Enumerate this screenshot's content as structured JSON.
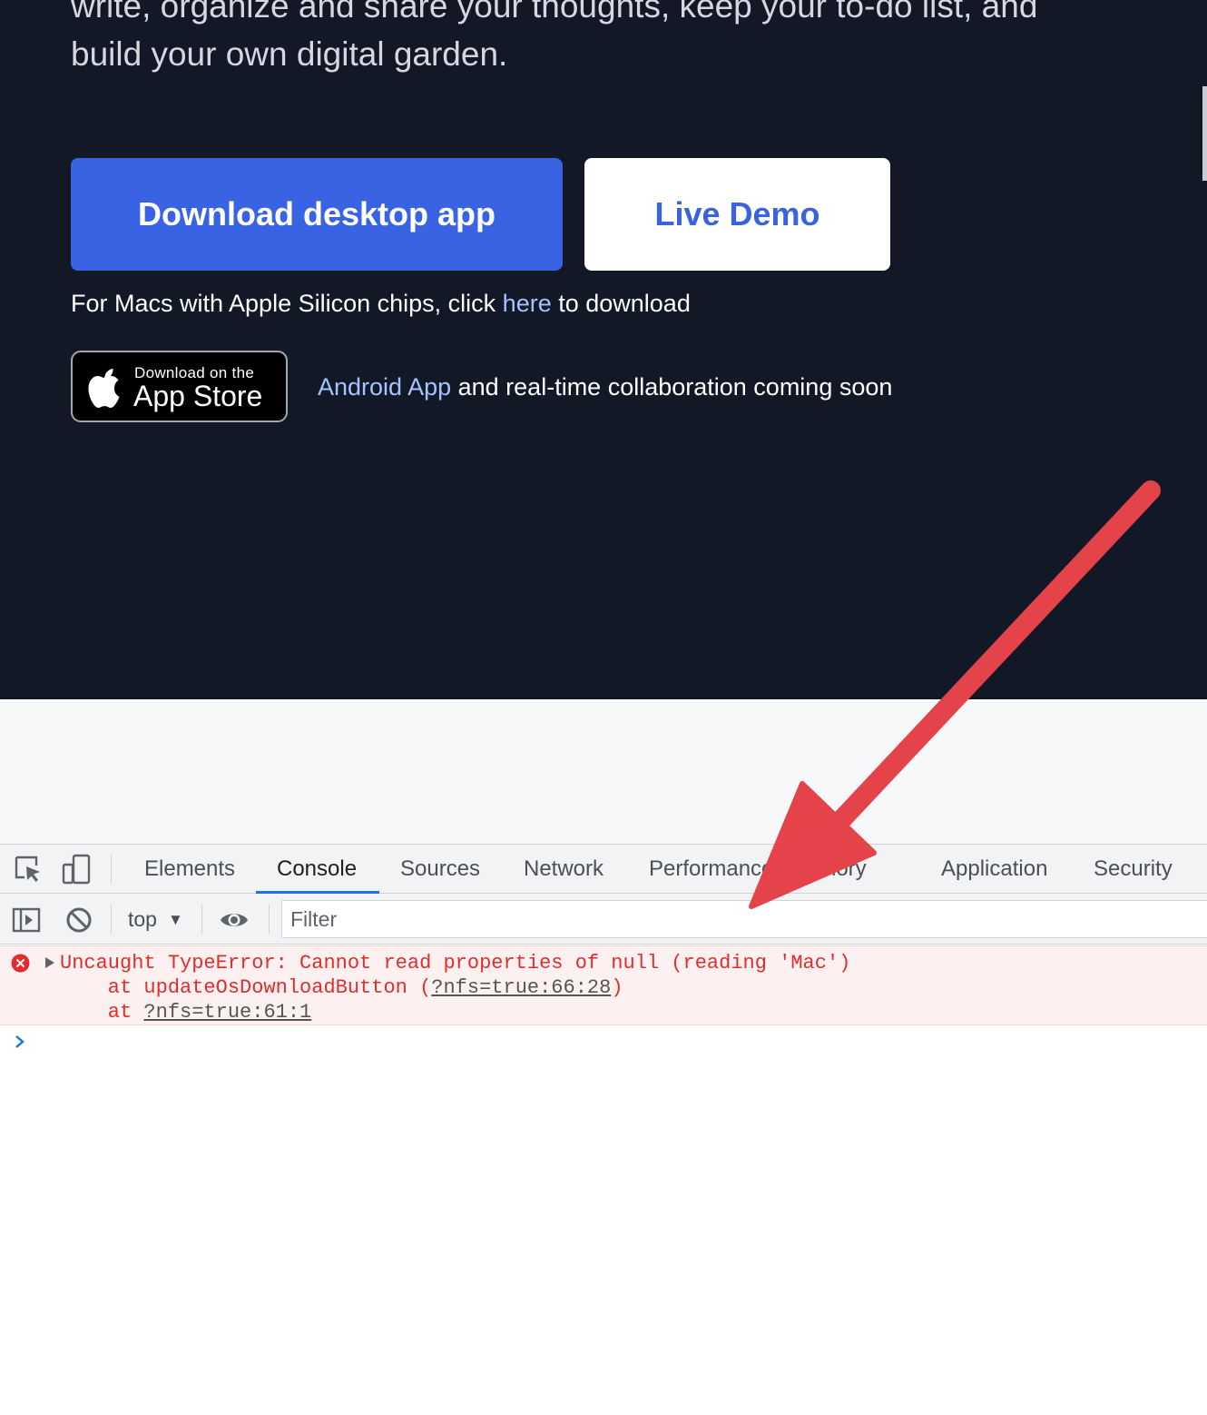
{
  "hero": {
    "intro_line1": "write, organize and share your thoughts, keep your to-do list, and",
    "intro_line2": "build your own digital garden.",
    "download_button": "Download desktop app",
    "demo_button": "Live Demo",
    "silicon_prefix": "For Macs with Apple Silicon chips, click ",
    "silicon_link": "here",
    "silicon_suffix": " to download",
    "appstore_small": "Download on the",
    "appstore_big": "App Store",
    "android_link": "Android App",
    "android_suffix": " and real-time collaboration coming soon"
  },
  "devtools": {
    "tabs": [
      "Elements",
      "Console",
      "Sources",
      "Network",
      "Performance",
      "Memory",
      "Application",
      "Security"
    ],
    "active_tab": "Console",
    "context": "top",
    "filter_placeholder": "Filter",
    "error": {
      "message": "Uncaught TypeError: Cannot read properties of null (reading 'Mac')",
      "trace1_prefix": "    at updateOsDownloadButton (",
      "trace1_link": "?nfs=true:66:28",
      "trace1_suffix": ")",
      "trace2_prefix": "    at ",
      "trace2_link": "?nfs=true:61:1"
    }
  },
  "colors": {
    "hero_bg": "#131827",
    "primary": "#3a63e4",
    "link": "#a4c4ff",
    "error_text": "#e02d2d",
    "error_bg": "#fdf0f0",
    "annotation_arrow": "#e5434a"
  },
  "icons": [
    "apple-icon",
    "inspect-element-icon",
    "device-toggle-icon",
    "sidebar-toggle-icon",
    "clear-console-icon",
    "eye-icon",
    "error-icon",
    "expand-triangle-icon",
    "console-prompt-icon"
  ]
}
